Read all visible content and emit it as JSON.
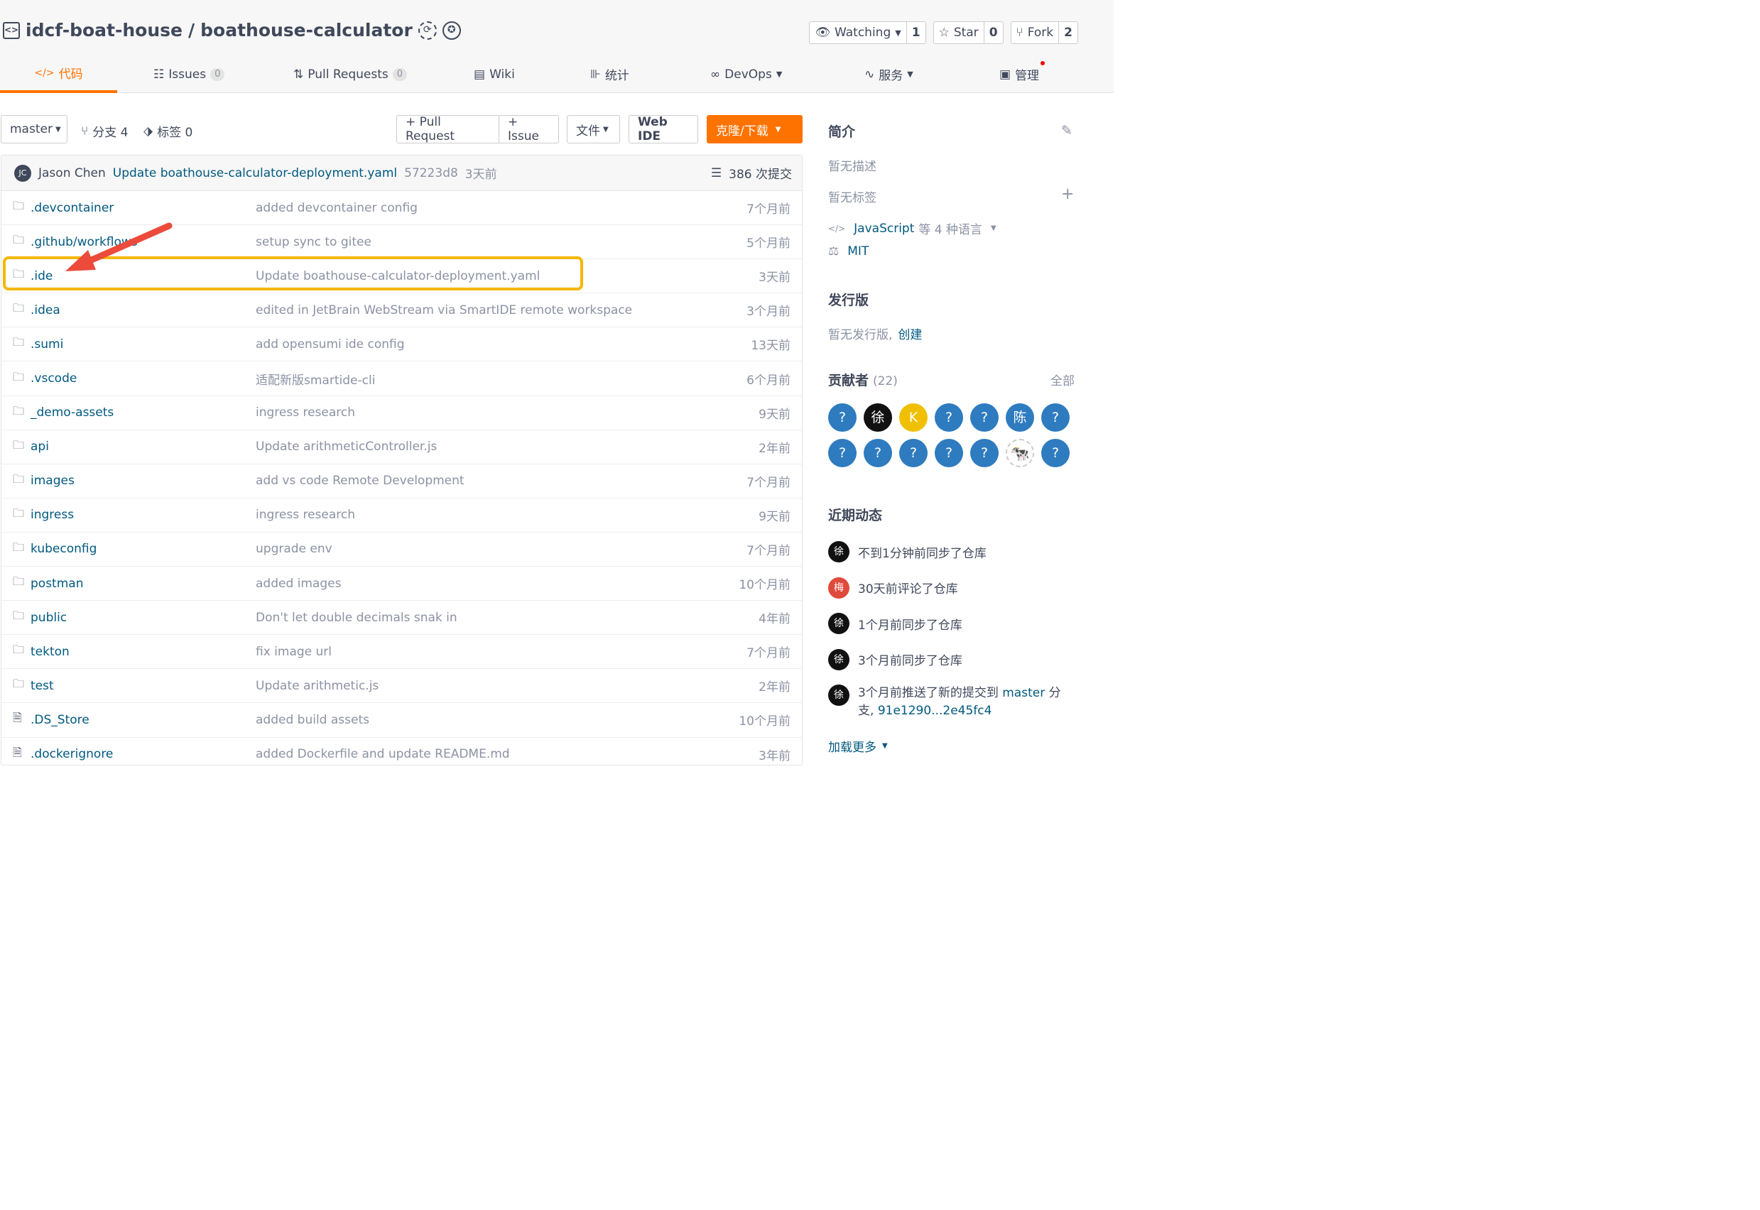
{
  "repo": {
    "owner": "idcf-boat-house",
    "separator": "/",
    "name": "boathouse-calculator"
  },
  "actions": [
    {
      "label": "Watching",
      "count": "1"
    },
    {
      "label": "Star",
      "count": "0"
    },
    {
      "label": "Fork",
      "count": "2"
    }
  ],
  "tabs": [
    {
      "label": "代码"
    },
    {
      "label": "Issues",
      "count": "0"
    },
    {
      "label": "Pull Requests",
      "count": "0"
    },
    {
      "label": "Wiki"
    },
    {
      "label": "统计"
    },
    {
      "label": "DevOps"
    },
    {
      "label": "服务"
    },
    {
      "label": "管理"
    }
  ],
  "toolbar": {
    "branch": "master",
    "branches": "分支 4",
    "tags": "标签 0",
    "pull_request": "+ Pull Request",
    "issue": "+ Issue",
    "file": "文件",
    "web_ide": "Web IDE",
    "clone": "克隆/下载"
  },
  "commit": {
    "avatar": "JC",
    "author": "Jason Chen",
    "message": "Update boathouse-calculator-deployment.yaml",
    "sha": "57223d8",
    "time": "3天前",
    "count": "386 次提交"
  },
  "files": [
    {
      "icon": "folder",
      "name": ".devcontainer",
      "msg": "added devcontainer config",
      "time": "7个月前"
    },
    {
      "icon": "folder",
      "name": ".github/workflows",
      "msg": "setup sync to gitee",
      "time": "5个月前"
    },
    {
      "icon": "folder",
      "name": ".ide",
      "msg": "Update boathouse-calculator-deployment.yaml",
      "time": "3天前"
    },
    {
      "icon": "folder",
      "name": ".idea",
      "msg": "edited in JetBrain WebStream via SmartIDE remote workspace",
      "time": "3个月前"
    },
    {
      "icon": "folder",
      "name": ".sumi",
      "msg": "add opensumi ide config",
      "time": "13天前"
    },
    {
      "icon": "folder",
      "name": ".vscode",
      "msg": "适配新版smartide-cli",
      "time": "6个月前"
    },
    {
      "icon": "folder",
      "name": "_demo-assets",
      "msg": "ingress research",
      "time": "9天前"
    },
    {
      "icon": "folder",
      "name": "api",
      "msg": "Update arithmeticController.js",
      "time": "2年前"
    },
    {
      "icon": "folder",
      "name": "images",
      "msg": "add vs code Remote Development",
      "time": "7个月前"
    },
    {
      "icon": "folder",
      "name": "ingress",
      "msg": "ingress research",
      "time": "9天前"
    },
    {
      "icon": "folder",
      "name": "kubeconfig",
      "msg": "upgrade env",
      "time": "7个月前"
    },
    {
      "icon": "folder",
      "name": "postman",
      "msg": "added images",
      "time": "10个月前"
    },
    {
      "icon": "folder",
      "name": "public",
      "msg": "Don't let double decimals snak in",
      "time": "4年前"
    },
    {
      "icon": "folder",
      "name": "tekton",
      "msg": "fix image url",
      "time": "7个月前"
    },
    {
      "icon": "folder",
      "name": "test",
      "msg": "Update arithmetic.js",
      "time": "2年前"
    },
    {
      "icon": "file",
      "name": ".DS_Store",
      "msg": "added build assets",
      "time": "10个月前"
    },
    {
      "icon": "file",
      "name": ".dockerignore",
      "msg": "added Dockerfile and update README.md",
      "time": "3年前"
    }
  ],
  "sidebar": {
    "intro_title": "简介",
    "no_desc": "暂无描述",
    "no_tags": "暂无标签",
    "language": "JavaScript",
    "language_more": "等 4 种语言",
    "license": "MIT",
    "release_title": "发行版",
    "no_release": "暂无发行版,",
    "create": "创建",
    "contrib_title": "贡献者",
    "contrib_count": "(22)",
    "all": "全部",
    "contributors": [
      "?",
      "徐",
      "K",
      "?",
      "?",
      "陈",
      "?",
      "?",
      "?",
      "?",
      "?",
      "?",
      "",
      "?"
    ],
    "activity_title": "近期动态",
    "activities": [
      {
        "avatar": "徐",
        "color": "#111111",
        "text": "不到1分钟前同步了仓库"
      },
      {
        "avatar": "梅",
        "color": "#e04a3a",
        "text": "30天前评论了仓库"
      },
      {
        "avatar": "徐",
        "color": "#111111",
        "text": "1个月前同步了仓库"
      },
      {
        "avatar": "徐",
        "color": "#111111",
        "text": "3个月前同步了仓库"
      }
    ],
    "activity_last": {
      "avatar": "徐",
      "pre": "3个月前推送了新的提交到",
      "branch": "master",
      "mid": "分支,",
      "range": "91e1290...2e45fc4"
    },
    "load_more": "加载更多"
  },
  "colors": {
    "accent": "#fe7300",
    "link": "#005980",
    "highlight": "#f5b700",
    "arrow": "#ec4b3c",
    "contrib_blue": "#2e7bbf",
    "contrib_yellow": "#f0c000"
  }
}
